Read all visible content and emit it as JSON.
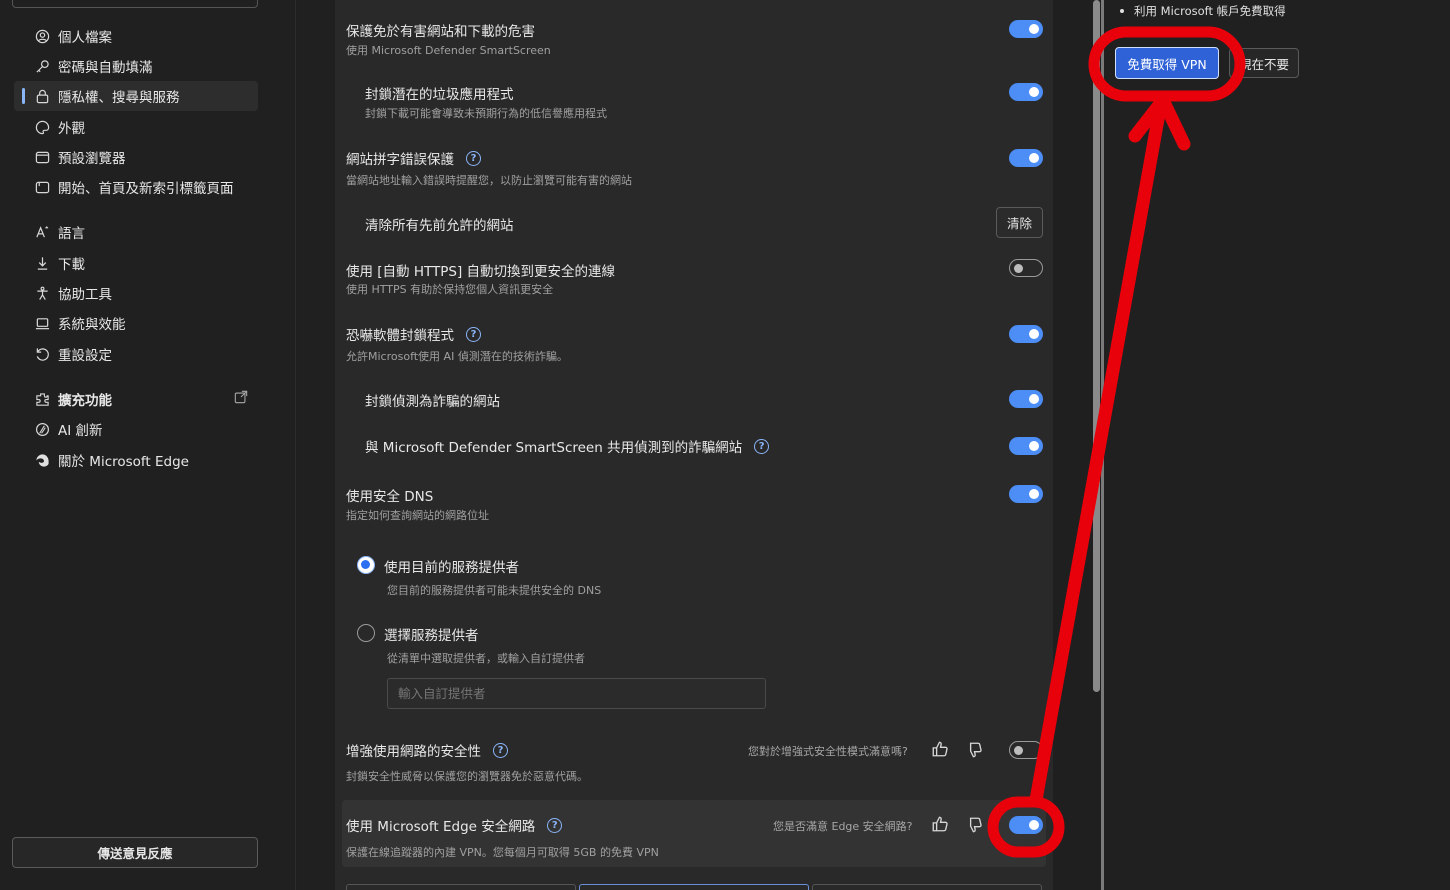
{
  "sidebar": {
    "items": [
      {
        "label": "個人檔案",
        "icon": "profile-icon"
      },
      {
        "label": "密碼與自動填滿",
        "icon": "key-icon"
      },
      {
        "label": "隱私權、搜尋與服務",
        "icon": "lock-icon"
      },
      {
        "label": "外觀",
        "icon": "palette-icon"
      },
      {
        "label": "預設瀏覽器",
        "icon": "browser-icon"
      },
      {
        "label": "開始、首頁及新索引標籤頁面",
        "icon": "home-tab-icon"
      },
      {
        "label": "語言",
        "icon": "language-icon"
      },
      {
        "label": "下載",
        "icon": "download-icon"
      },
      {
        "label": "協助工具",
        "icon": "accessibility-icon"
      },
      {
        "label": "系統與效能",
        "icon": "laptop-icon"
      },
      {
        "label": "重設設定",
        "icon": "reset-icon"
      },
      {
        "label": "擴充功能",
        "icon": "extensions-icon"
      },
      {
        "label": "AI 創新",
        "icon": "ai-icon"
      },
      {
        "label": "關於 Microsoft Edge",
        "icon": "edge-icon"
      }
    ],
    "feedback_label": "傳送意見反應"
  },
  "settings": {
    "smartscreen": {
      "title": "保護免於有害網站和下載的危害",
      "sub": "使用 Microsoft Defender SmartScreen",
      "on": true
    },
    "pua": {
      "title": "封鎖潛在的垃圾應用程式",
      "sub": "封鎖下載可能會導致未預期行為的低信譽應用程式",
      "on": true
    },
    "typo": {
      "title": "網站拼字錯誤保護",
      "sub": "當網站地址輸入錯誤時提醒您，以防止瀏覽可能有害的網站",
      "on": true
    },
    "clear_allowed": {
      "title": "清除所有先前允許的網站",
      "button": "清除"
    },
    "https": {
      "title": "使用 [自動 HTTPS] 自動切換到更安全的連線",
      "sub": "使用 HTTPS 有助於保持您個人資訊更安全",
      "on": false
    },
    "scareware": {
      "title": "恐嚇軟體封鎖程式",
      "sub": "允許Microsoft使用 AI 偵測潛在的技術詐騙。",
      "on": true
    },
    "block_scam": {
      "title": "封鎖偵測為詐騙的網站",
      "on": true
    },
    "share_scam": {
      "title": "與 Microsoft Defender SmartScreen 共用偵測到的詐騙網站",
      "on": true
    },
    "dns": {
      "title": "使用安全 DNS",
      "sub": "指定如何查詢網站的網路位址",
      "on": true
    },
    "dns_current": {
      "title": "使用目前的服務提供者",
      "sub": "您目前的服務提供者可能未提供安全的 DNS",
      "selected": true
    },
    "dns_choose": {
      "title": "選擇服務提供者",
      "sub": "從清單中選取提供者，或輸入自訂提供者",
      "selected": false
    },
    "custom_provider": {
      "placeholder": "輸入自訂提供者"
    },
    "enhanced": {
      "title": "增強使用網路的安全性",
      "sub": "封鎖安全性威脅以保護您的瀏覽器免於惡意代碼。",
      "feedback": "您對於增強式安全性模式滿意嗎?",
      "on": false
    },
    "secure_network": {
      "title": "使用 Microsoft Edge 安全網路",
      "sub": "保護在線追蹤器的內建 VPN。您每個月可取得 5GB 的免費 VPN",
      "feedback": "您是否滿意 Edge 安全網路?",
      "on": true
    }
  },
  "rightpane": {
    "bullet": "利用 Microsoft 帳戶免費取得",
    "get_vpn": "免費取得 VPN",
    "not_now": "現在不要"
  },
  "colors": {
    "accent": "#4c8df6",
    "annotation": "#e8000b",
    "background": "#202020",
    "panel": "#292929"
  }
}
